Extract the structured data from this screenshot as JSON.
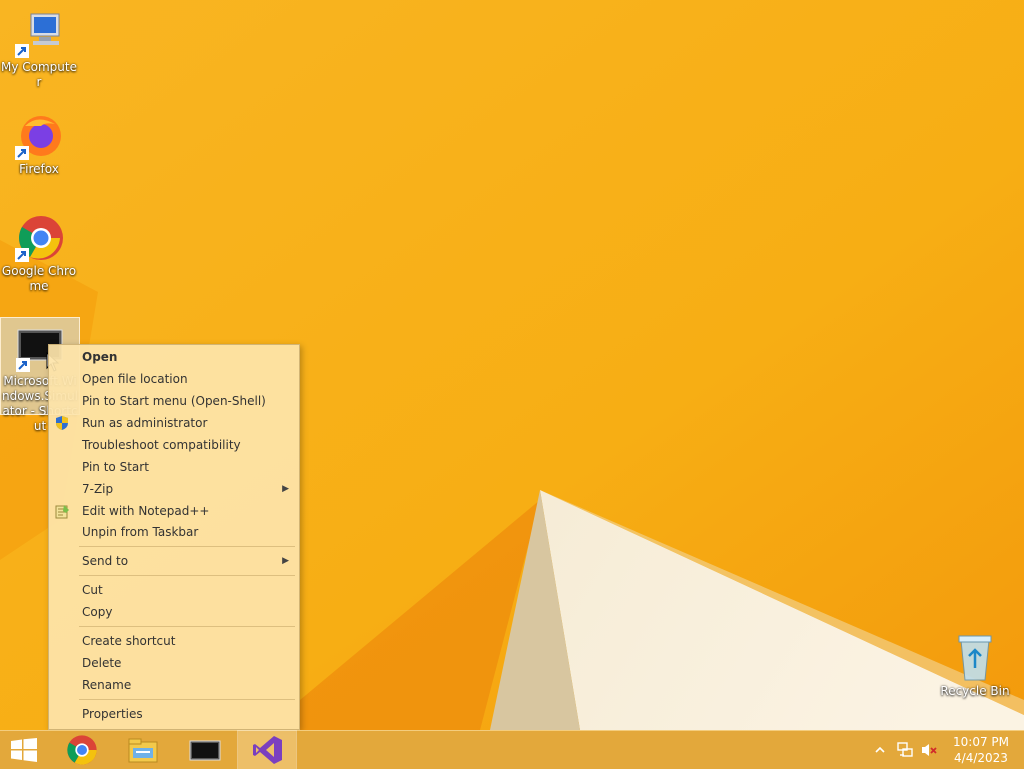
{
  "desktop": {
    "icons": [
      {
        "label": "My Computer",
        "icon": "computer-icon"
      },
      {
        "label": "Firefox",
        "icon": "firefox-icon"
      },
      {
        "label": "Google Chrome",
        "icon": "chrome-icon"
      },
      {
        "label": "Microsoft.Windows.Simulator - Shortcut",
        "icon": "simulator-icon",
        "selected": true
      },
      {
        "label": "Recycle Bin",
        "icon": "recycle-bin-icon"
      }
    ]
  },
  "context_menu": {
    "items": [
      {
        "label": "Open",
        "bold": true
      },
      {
        "label": "Open file location"
      },
      {
        "label": "Pin to Start menu (Open-Shell)"
      },
      {
        "label": "Run as administrator",
        "icon": "shield-icon"
      },
      {
        "label": "Troubleshoot compatibility"
      },
      {
        "label": "Pin to Start"
      },
      {
        "label": "7-Zip",
        "submenu": true
      },
      {
        "label": "Edit with Notepad++",
        "icon": "notepad-icon"
      },
      {
        "label": "Unpin from Taskbar"
      },
      {
        "label": "Send to",
        "submenu": true
      },
      {
        "label": "Cut"
      },
      {
        "label": "Copy"
      },
      {
        "label": "Create shortcut"
      },
      {
        "label": "Delete"
      },
      {
        "label": "Rename"
      },
      {
        "label": "Properties"
      }
    ]
  },
  "taskbar": {
    "buttons": [
      {
        "icon": "windows-start-icon"
      },
      {
        "icon": "chrome-icon"
      },
      {
        "icon": "file-explorer-icon"
      },
      {
        "icon": "simulator-icon"
      },
      {
        "icon": "visual-studio-icon",
        "active": true
      }
    ],
    "tray": {
      "icons": [
        "show-hidden-icons-chevron-icon",
        "network-icon",
        "volume-muted-icon"
      ],
      "time": "10:07 PM",
      "date": "4/4/2023"
    }
  },
  "colors": {
    "wallpaper_base": "#f7b21a",
    "menu_background": "#fde4aa",
    "taskbar": "#e2a83c"
  }
}
